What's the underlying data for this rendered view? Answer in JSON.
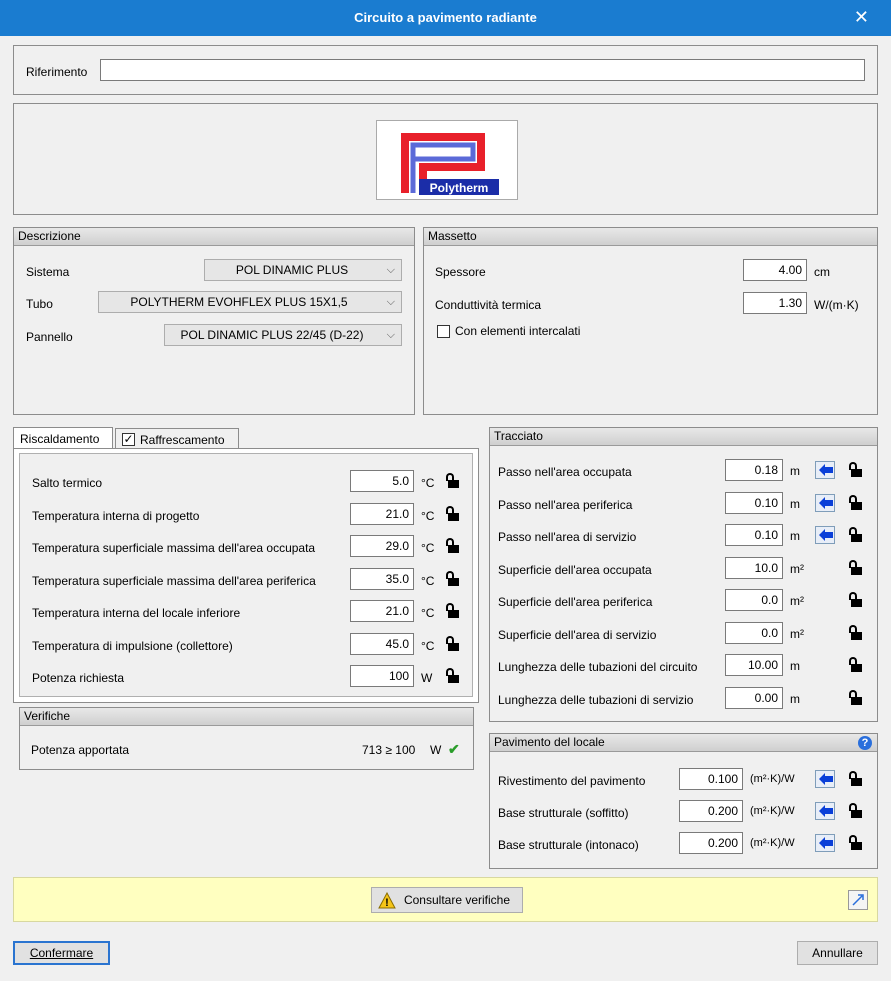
{
  "window": {
    "title": "Circuito a pavimento radiante",
    "close_glyph": "✕"
  },
  "riferimento": {
    "label": "Riferimento",
    "value": ""
  },
  "logo": {
    "brand": "Polytherm",
    "icon": "polytherm-logo-icon"
  },
  "descrizione": {
    "header": "Descrizione",
    "sistema_label": "Sistema",
    "sistema_value": "POL DINAMIC PLUS",
    "tubo_label": "Tubo",
    "tubo_value": "POLYTHERM EVOHFLEX PLUS 15X1,5",
    "pannello_label": "Pannello",
    "pannello_value": "POL DINAMIC PLUS 22/45 (D-22)"
  },
  "massetto": {
    "header": "Massetto",
    "spessore_label": "Spessore",
    "spessore_value": "4.00",
    "spessore_unit": "cm",
    "cond_label": "Conduttività termica",
    "cond_value": "1.30",
    "cond_unit": "W/(m·K)",
    "intercalati_label": "Con elementi intercalati",
    "intercalati_checked": false
  },
  "tabs": {
    "riscaldamento": "Riscaldamento",
    "raffrescamento": "Raffrescamento",
    "raffrescamento_checked": true,
    "check_glyph": "✓"
  },
  "riscaldamento_rows": [
    {
      "label": "Salto termico",
      "value": "5.0",
      "unit": "°C"
    },
    {
      "label": "Temperatura interna di progetto",
      "value": "21.0",
      "unit": "°C"
    },
    {
      "label": "Temperatura superficiale massima dell'area occupata",
      "value": "29.0",
      "unit": "°C"
    },
    {
      "label": "Temperatura superficiale massima dell'area periferica",
      "value": "35.0",
      "unit": "°C"
    },
    {
      "label": "Temperatura interna del locale inferiore",
      "value": "21.0",
      "unit": "°C"
    },
    {
      "label": "Temperatura di impulsione (collettore)",
      "value": "45.0",
      "unit": "°C"
    },
    {
      "label": "Potenza richiesta",
      "value": "100",
      "unit": "W"
    }
  ],
  "verifiche": {
    "header": "Verifiche",
    "label": "Potenza apportata",
    "value": "713 ≥ 100",
    "unit": "W",
    "ok_glyph": "✔",
    "ok_color": "#2a9d2a"
  },
  "tracciato": {
    "header": "Tracciato",
    "rows": [
      {
        "label": "Passo nell'area occupata",
        "value": "0.18",
        "unit": "m"
      },
      {
        "label": "Passo nell'area periferica",
        "value": "0.10",
        "unit": "m"
      },
      {
        "label": "Passo nell'area di servizio",
        "value": "0.10",
        "unit": "m"
      },
      {
        "label": "Superficie dell'area occupata",
        "value": "10.0",
        "unit": "m²"
      },
      {
        "label": "Superficie dell'area periferica",
        "value": "0.0",
        "unit": "m²"
      },
      {
        "label": "Superficie dell'area di servizio",
        "value": "0.0",
        "unit": "m²"
      },
      {
        "label": "Lunghezza delle tubazioni del circuito",
        "value": "10.00",
        "unit": "m"
      },
      {
        "label": "Lunghezza delle tubazioni di servizio",
        "value": "0.00",
        "unit": "m"
      }
    ]
  },
  "pavimento": {
    "header": "Pavimento del locale",
    "help_glyph": "?",
    "rows": [
      {
        "label": "Rivestimento del pavimento",
        "value": "0.100",
        "unit": "(m²·K)/W"
      },
      {
        "label": "Base strutturale (soffitto)",
        "value": "0.200",
        "unit": "(m²·K)/W"
      },
      {
        "label": "Base strutturale (intonaco)",
        "value": "0.200",
        "unit": "(m²·K)/W"
      }
    ]
  },
  "verify_bar": {
    "button_label": "Consultare verifiche",
    "bg": "#ffffc0",
    "warn_glyph": "!"
  },
  "footer": {
    "confirm": "Confermare",
    "cancel": "Annullare"
  },
  "colors": {
    "title_bar": "#1a7cd0",
    "arrow_blue": "#0a3fd8"
  }
}
